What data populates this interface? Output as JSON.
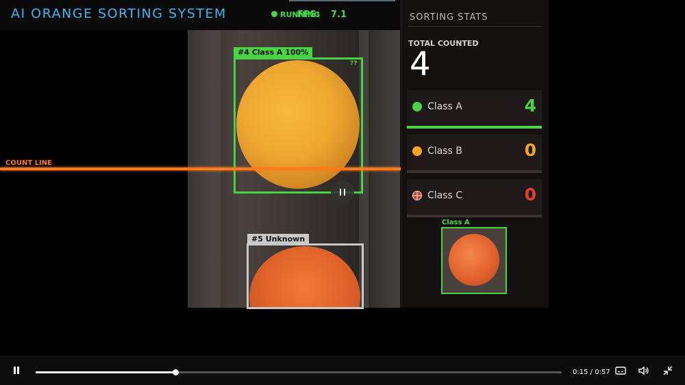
{
  "header": {
    "app_title": "AI ORANGE SORTING SYSTEM",
    "status": "RUNNING",
    "fps_label": "FPS:",
    "fps_value": "7.1"
  },
  "video_overlay": {
    "count_line_label": "COUNT LINE",
    "detections": [
      {
        "label": "#4  Class A  100%",
        "color": "#48d544",
        "corner_tag": "??"
      },
      {
        "label": "#5  Unknown",
        "color": "#c9c9c9"
      }
    ]
  },
  "stats": {
    "title": "SORTING STATS",
    "total_label": "TOTAL COUNTED",
    "total_value": "4",
    "classes": [
      {
        "name": "Class A",
        "count": "4",
        "color": "#48d544",
        "fill": 1.0
      },
      {
        "name": "Class B",
        "count": "0",
        "color": "#f5a623",
        "fill": 0.0
      },
      {
        "name": "Class C",
        "count": "0",
        "color": "#e0402f",
        "fill": 0.0
      }
    ],
    "last_sample_label": "Class A"
  },
  "player": {
    "current_time": "0:15",
    "separator": "/",
    "duration": "0:57",
    "progress_fraction": 0.265,
    "icons": [
      "pause-icon",
      "captions-icon",
      "volume-icon",
      "exit-fullscreen-icon"
    ]
  }
}
